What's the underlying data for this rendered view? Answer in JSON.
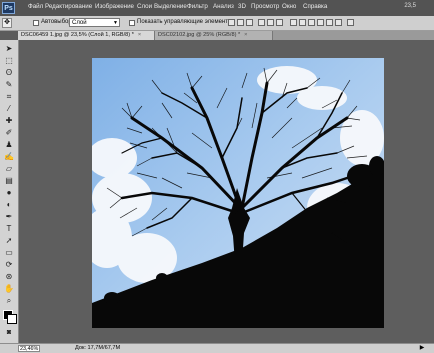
{
  "app": {
    "logo": "Ps"
  },
  "menubar": {
    "items": [
      "Файл",
      "Редактирование",
      "Изображение",
      "Слои",
      "Выделение",
      "Фильтр",
      "Анализ",
      "3D",
      "Просмотр",
      "Окно",
      "Справка"
    ],
    "zoom": "23,5"
  },
  "options": {
    "autoselect_label": "Автовыбор:",
    "autoselect_value": "Слой",
    "show_controls_label": "Показать управляющие элементы"
  },
  "tabs": [
    {
      "label": "DSC06459 1.jpg @ 23,5% (Слой 1, RGB/8) *",
      "close": "×"
    },
    {
      "label": "DSC02102.jpg @ 25% (RGB/8) *",
      "close": "×"
    }
  ],
  "status": {
    "zoom": "23,46%",
    "doc": "Док: 17,7M/67,7M"
  },
  "colors": {
    "sky": "#8fb6e0",
    "silhouette": "#080808"
  }
}
